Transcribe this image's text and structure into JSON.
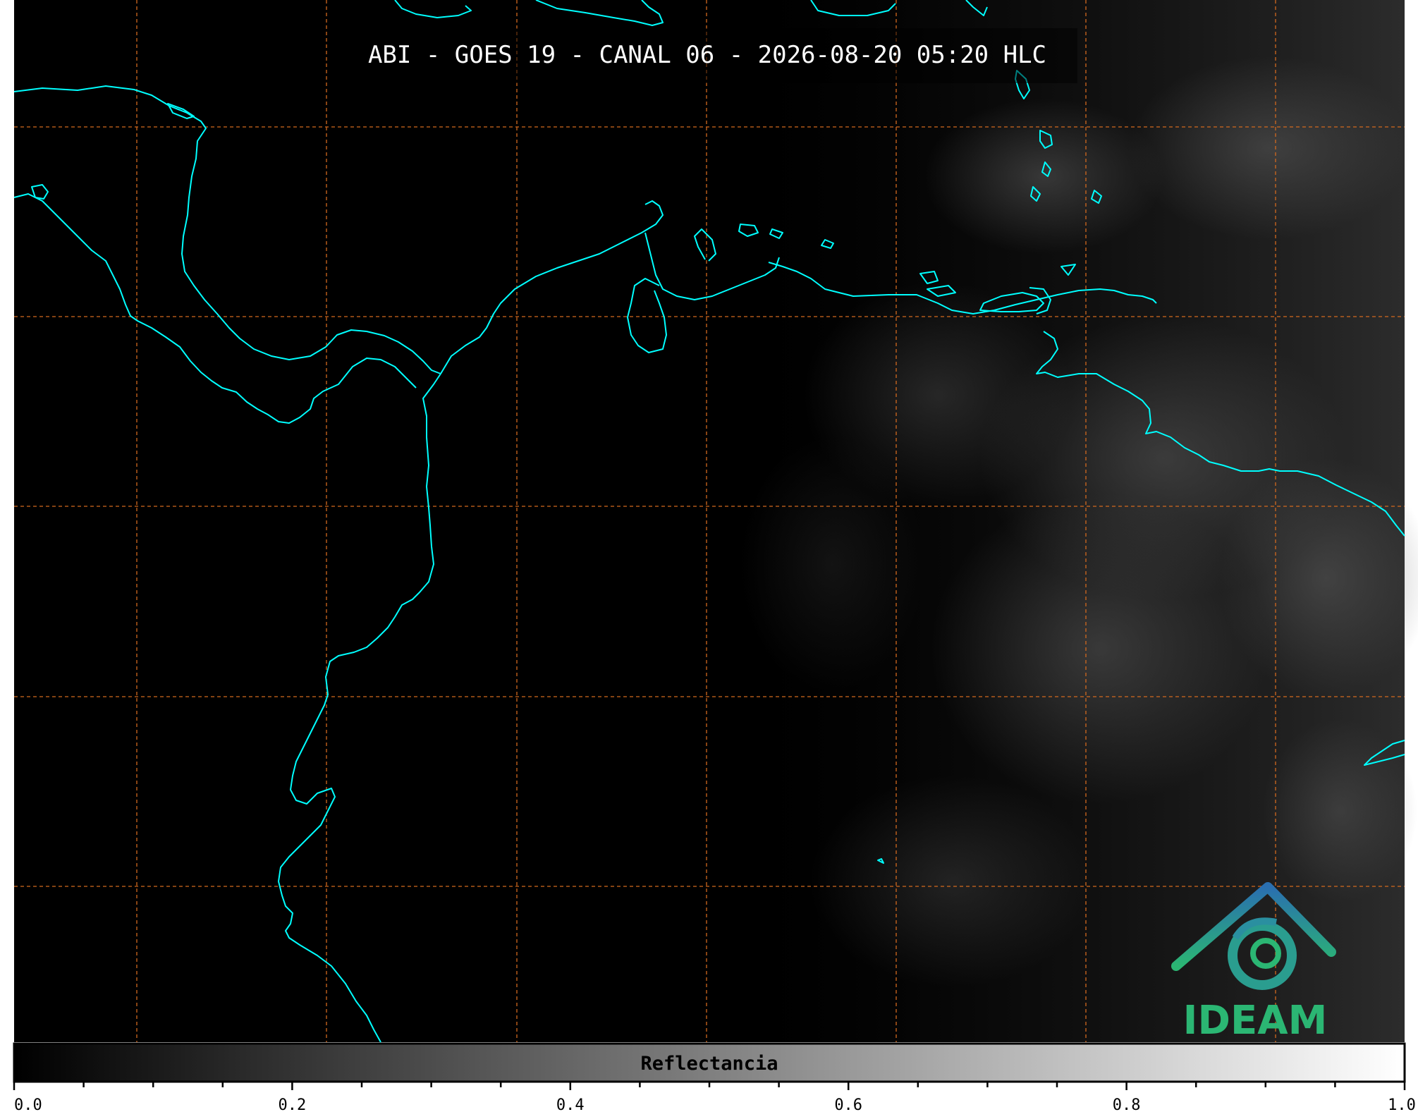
{
  "title": "ABI - GOES 19 - CANAL 06 - 2026-08-20 05:20 HLC",
  "colorbar": {
    "label": "Reflectancia",
    "ticks": [
      "0.0",
      "0.2",
      "0.4",
      "0.6",
      "0.8",
      "1.0"
    ],
    "range": [
      0.0,
      1.0
    ],
    "colormap": [
      "#000000",
      "#ffffff"
    ]
  },
  "logo": {
    "text": "IDEAM",
    "colors": {
      "top": "#2a6fb0",
      "bottom": "#2bb673"
    }
  },
  "colors": {
    "coastline": "#00ffff",
    "gridlines": "#d2691e",
    "background": "#000000"
  },
  "grid": {
    "style": "dashed",
    "lines_vertical": 7,
    "lines_horizontal": 5
  }
}
